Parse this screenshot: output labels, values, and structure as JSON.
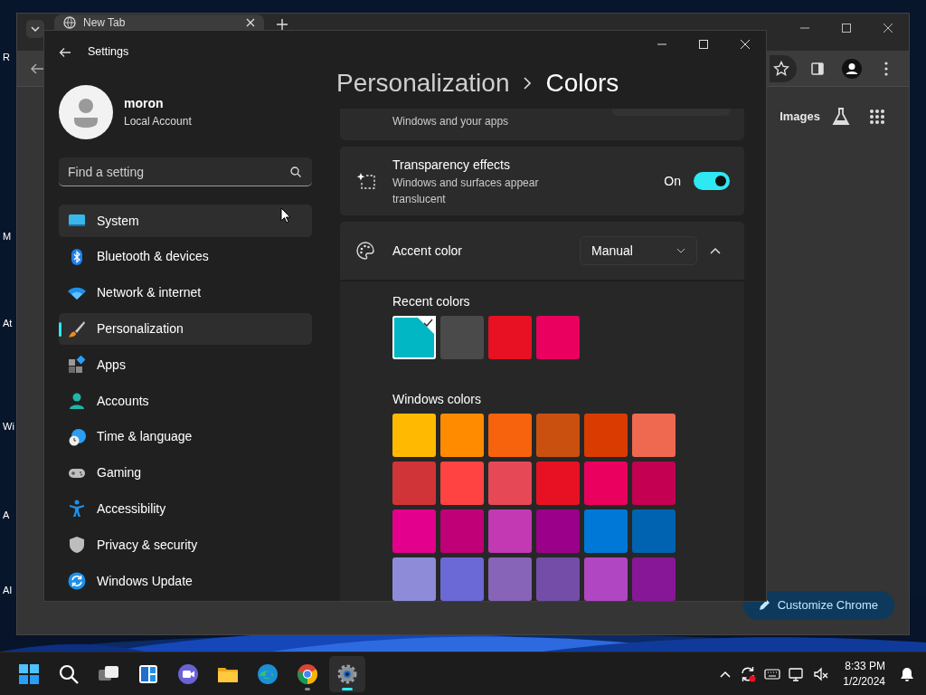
{
  "desktop": {
    "icon_labels": [
      "R",
      "M",
      "At",
      "Wi",
      "A",
      "AI"
    ]
  },
  "browser": {
    "tab": {
      "title": "New Tab"
    },
    "links": [
      "Images"
    ],
    "customize_button": "Customize Chrome"
  },
  "settings": {
    "title": "Settings",
    "user": {
      "name": "moron",
      "account": "Local Account"
    },
    "search": {
      "placeholder": "Find a setting"
    },
    "nav": [
      {
        "label": "System",
        "selected": false,
        "hovered": true
      },
      {
        "label": "Bluetooth & devices",
        "selected": false,
        "hovered": false
      },
      {
        "label": "Network & internet",
        "selected": false,
        "hovered": false
      },
      {
        "label": "Personalization",
        "selected": true,
        "hovered": false
      },
      {
        "label": "Apps",
        "selected": false,
        "hovered": false
      },
      {
        "label": "Accounts",
        "selected": false,
        "hovered": false
      },
      {
        "label": "Time & language",
        "selected": false,
        "hovered": false
      },
      {
        "label": "Gaming",
        "selected": false,
        "hovered": false
      },
      {
        "label": "Accessibility",
        "selected": false,
        "hovered": false
      },
      {
        "label": "Privacy & security",
        "selected": false,
        "hovered": false
      },
      {
        "label": "Windows Update",
        "selected": false,
        "hovered": false
      }
    ],
    "breadcrumb": [
      "Personalization",
      "Colors"
    ],
    "partial_card": {
      "description": "Windows and your apps"
    },
    "transparency": {
      "title": "Transparency effects",
      "description": "Windows and surfaces appear translucent",
      "state_label": "On",
      "on": true
    },
    "accent": {
      "title": "Accent color",
      "mode": "Manual",
      "expanded": true,
      "recent_label": "Recent colors",
      "recent": [
        {
          "color": "#00b7c3",
          "selected": true
        },
        {
          "color": "#4a4a4a",
          "selected": false
        },
        {
          "color": "#e81123",
          "selected": false
        },
        {
          "color": "#ea005e",
          "selected": false
        }
      ],
      "windows_label": "Windows colors",
      "windows": [
        {
          "color": "#ffb900"
        },
        {
          "color": "#ff8c00"
        },
        {
          "color": "#f7630c"
        },
        {
          "color": "#ca5010"
        },
        {
          "color": "#da3b01"
        },
        {
          "color": "#ef6950"
        },
        {
          "color": "#d13438"
        },
        {
          "color": "#ff4343"
        },
        {
          "color": "#e74856"
        },
        {
          "color": "#e81123"
        },
        {
          "color": "#ea005e"
        },
        {
          "color": "#c30052"
        },
        {
          "color": "#e3008c"
        },
        {
          "color": "#bf0077"
        },
        {
          "color": "#c239b3"
        },
        {
          "color": "#9a0089"
        },
        {
          "color": "#0078d7"
        },
        {
          "color": "#0063b1"
        },
        {
          "color": "#8e8cd8"
        },
        {
          "color": "#6b69d6"
        },
        {
          "color": "#8764b8"
        },
        {
          "color": "#744da9"
        },
        {
          "color": "#b146c2"
        },
        {
          "color": "#881798"
        }
      ]
    }
  },
  "taskbar": {
    "apps": [
      {
        "running": false,
        "selected": false
      },
      {
        "running": false,
        "selected": false
      },
      {
        "running": false,
        "selected": false
      },
      {
        "running": false,
        "selected": false
      },
      {
        "running": false,
        "selected": false
      },
      {
        "running": false,
        "selected": false
      },
      {
        "running": false,
        "selected": false
      },
      {
        "running": true,
        "selected": false
      },
      {
        "running": true,
        "selected": true
      }
    ],
    "time": "8:33 PM",
    "date": "1/2/2024"
  }
}
